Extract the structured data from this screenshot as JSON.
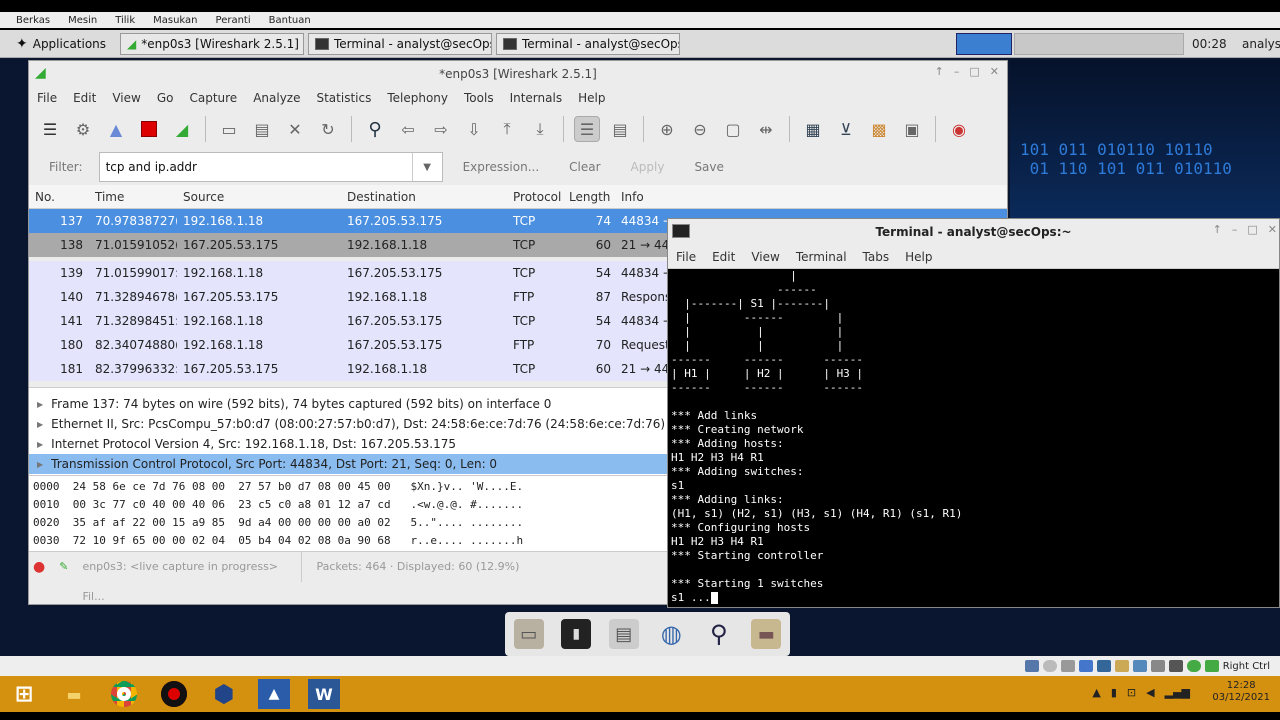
{
  "vb_menu": [
    "Berkas",
    "Mesin",
    "Tilik",
    "Masukan",
    "Peranti",
    "Bantuan"
  ],
  "taskbar": {
    "apps": "Applications",
    "tasks": [
      "*enp0s3 [Wireshark 2.5.1]",
      "Terminal - analyst@secOps:~",
      "Terminal - analyst@secOps:~"
    ],
    "clock": "00:28",
    "user": "analyst"
  },
  "wireshark": {
    "title": "*enp0s3 [Wireshark 2.5.1]",
    "menu": [
      "File",
      "Edit",
      "View",
      "Go",
      "Capture",
      "Analyze",
      "Statistics",
      "Telephony",
      "Tools",
      "Internals",
      "Help"
    ],
    "filter_label": "Filter:",
    "filter_value": "tcp and ip.addr",
    "filter_buttons": [
      "Expression...",
      "Clear",
      "Apply",
      "Save"
    ],
    "columns": [
      "No.",
      "Time",
      "Source",
      "Destination",
      "Protocol",
      "Length",
      "Info"
    ],
    "packets": [
      {
        "no": "137",
        "time": "70.97838727(",
        "src": "192.168.1.18",
        "dst": "167.205.53.175",
        "proto": "TCP",
        "len": "74",
        "info": "44834 →"
      },
      {
        "no": "138",
        "time": "71.01591052(",
        "src": "167.205.53.175",
        "dst": "192.168.1.18",
        "proto": "TCP",
        "len": "60",
        "info": "21 → 44834"
      },
      {
        "no": "139",
        "time": "71.01599017:",
        "src": "192.168.1.18",
        "dst": "167.205.53.175",
        "proto": "TCP",
        "len": "54",
        "info": "44834 →"
      },
      {
        "no": "140",
        "time": "71.32894678(",
        "src": "167.205.53.175",
        "dst": "192.168.1.18",
        "proto": "FTP",
        "len": "87",
        "info": "Respons"
      },
      {
        "no": "141",
        "time": "71.32898451:",
        "src": "192.168.1.18",
        "dst": "167.205.53.175",
        "proto": "TCP",
        "len": "54",
        "info": "44834 →"
      },
      {
        "no": "180",
        "time": "82.34074880(",
        "src": "192.168.1.18",
        "dst": "167.205.53.175",
        "proto": "FTP",
        "len": "70",
        "info": "Request"
      },
      {
        "no": "181",
        "time": "82.37996332:",
        "src": "167.205.53.175",
        "dst": "192.168.1.18",
        "proto": "TCP",
        "len": "60",
        "info": "21 → 44"
      }
    ],
    "details": [
      "Frame 137: 74 bytes on wire (592 bits), 74 bytes captured (592 bits) on interface 0",
      "Ethernet II, Src: PcsCompu_57:b0:d7 (08:00:27:57:b0:d7), Dst: 24:58:6e:ce:7d:76 (24:58:6e:ce:7d:76)",
      "Internet Protocol Version 4, Src: 192.168.1.18, Dst: 167.205.53.175",
      "Transmission Control Protocol, Src Port: 44834, Dst Port: 21, Seq: 0, Len: 0"
    ],
    "bytes": [
      "0000  24 58 6e ce 7d 76 08 00  27 57 b0 d7 08 00 45 00   $Xn.}v.. 'W....E.",
      "0010  00 3c 77 c0 40 00 40 06  23 c5 c0 a8 01 12 a7 cd   .<w.@.@. #.......",
      "0020  35 af af 22 00 15 a9 85  9d a4 00 00 00 00 a0 02   5..\".... ........",
      "0030  72 10 9f 65 00 00 02 04  05 b4 04 02 08 0a 90 68   r..e.... .......h"
    ],
    "status_capture": "enp0s3: <live capture in progress> Fil...",
    "status_packets": "Packets: 464 · Displayed: 60 (12.9%)"
  },
  "terminal": {
    "title": "Terminal - analyst@secOps:~",
    "menu": [
      "File",
      "Edit",
      "View",
      "Terminal",
      "Tabs",
      "Help"
    ],
    "lines": [
      "                  |",
      "                ------",
      "  |-------| S1 |-------|",
      "  |        ------        |",
      "  |          |           |",
      "  |          |           |",
      "------     ------      ------",
      "| H1 |     | H2 |      | H3 |",
      "------     ------      ------",
      "",
      "*** Add links",
      "*** Creating network",
      "*** Adding hosts:",
      "H1 H2 H3 H4 R1",
      "*** Adding switches:",
      "s1",
      "*** Adding links:",
      "(H1, s1) (H2, s1) (H3, s1) (H4, R1) (s1, R1)",
      "*** Configuring hosts",
      "H1 H2 H3 H4 R1",
      "*** Starting controller",
      "",
      "*** Starting 1 switches"
    ],
    "prompt": "s1 ..."
  },
  "vb_status": "Right Ctrl",
  "win_clock": {
    "time": "12:28",
    "date": "03/12/2021"
  },
  "bg_text": "101 011 010110 10110\n 01 110 101 011 010110"
}
